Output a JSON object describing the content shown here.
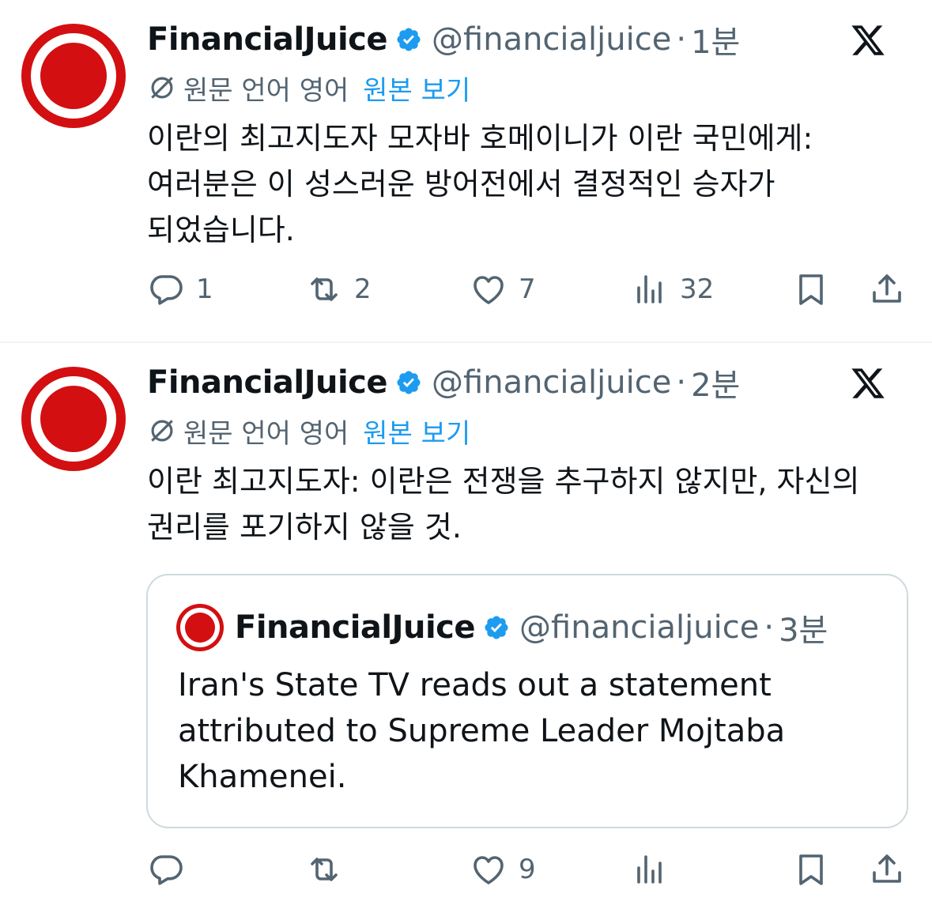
{
  "tweets": [
    {
      "author_name": "FinancialJuice",
      "handle": "@financialjuice",
      "separator": "·",
      "time": "1분",
      "translation_label": "원문 언어 영어",
      "show_original": "원본 보기",
      "text": "이란의 최고지도자 모자바 호메이니가 이란 국민에게: 여러분은 이 성스러운 방어전에서 결정적인 승자가 되었습니다.",
      "replies": "1",
      "reposts": "2",
      "likes": "7",
      "views": "32"
    },
    {
      "author_name": "FinancialJuice",
      "handle": "@financialjuice",
      "separator": "·",
      "time": "2분",
      "translation_label": "원문 언어 영어",
      "show_original": "원본 보기",
      "text": "이란 최고지도자: 이란은 전쟁을 추구하지 않지만, 자신의 권리를 포기하지 않을 것.",
      "replies": "",
      "reposts": "",
      "likes": "9",
      "views": "",
      "quote": {
        "author_name": "FinancialJuice",
        "handle": "@financialjuice",
        "separator": "·",
        "time": "3분",
        "text": "Iran's State TV reads out a statement attributed to Supreme Leader Mojtaba Khamenei."
      }
    }
  ],
  "colors": {
    "brand_red": "#d30f11",
    "link_blue": "#1d9bf0",
    "verified_blue": "#1d9bf0",
    "secondary_text": "#536471"
  },
  "icons": [
    "verified-badge-icon",
    "x-logo-icon",
    "translate-icon",
    "reply-icon",
    "repost-icon",
    "like-icon",
    "views-icon",
    "bookmark-icon",
    "share-icon"
  ]
}
